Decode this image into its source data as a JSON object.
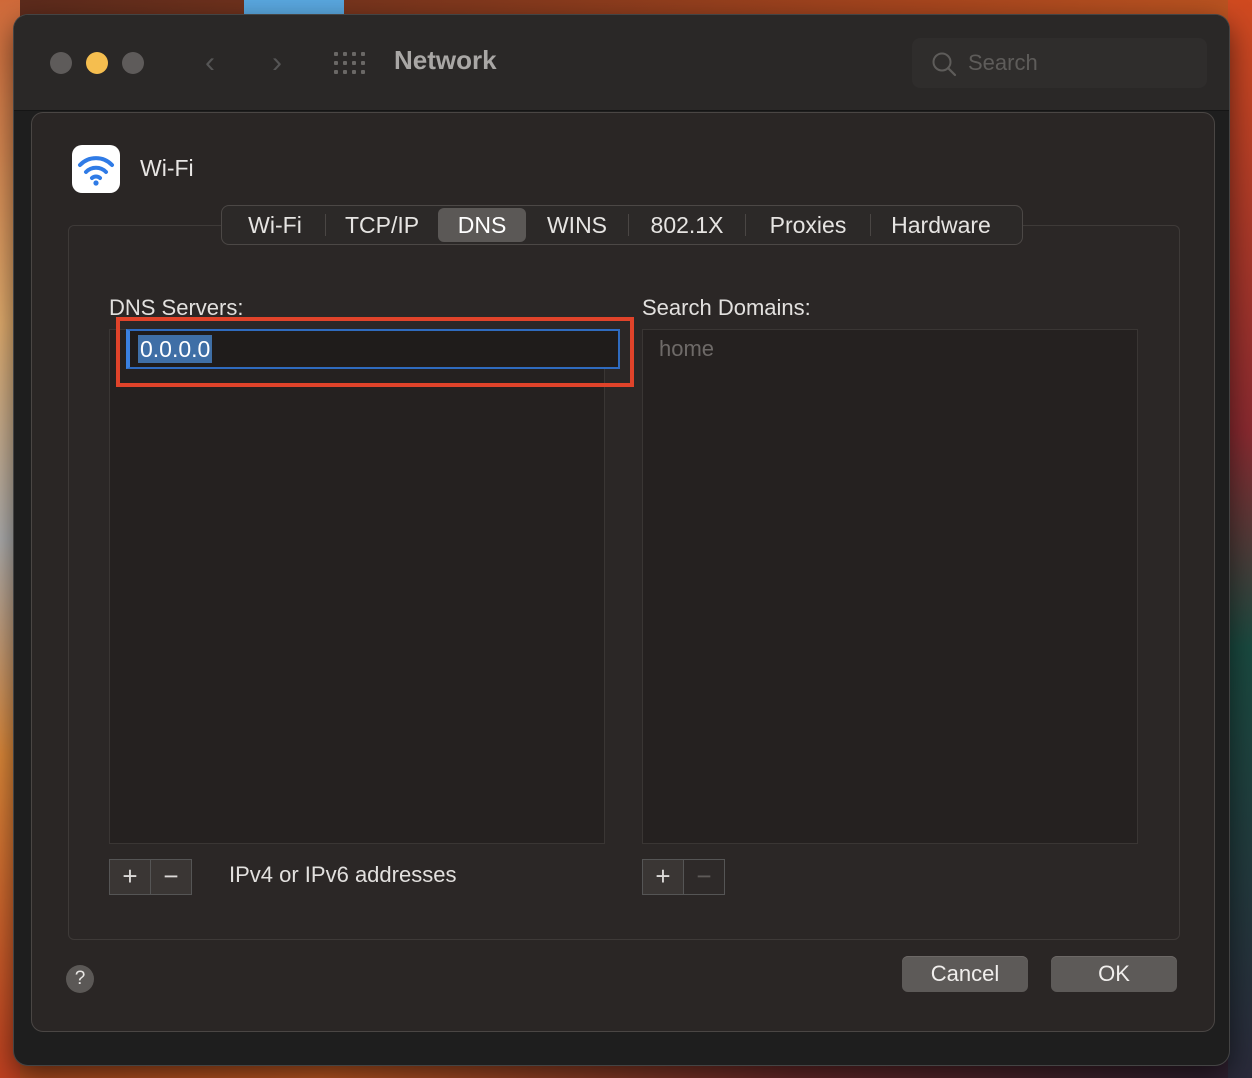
{
  "window": {
    "title": "Network"
  },
  "toolbar": {
    "search_placeholder": "Search"
  },
  "sheet": {
    "service_name": "Wi-Fi",
    "tabs": [
      {
        "label": "Wi-Fi"
      },
      {
        "label": "TCP/IP"
      },
      {
        "label": "DNS",
        "selected": true
      },
      {
        "label": "WINS"
      },
      {
        "label": "802.1X"
      },
      {
        "label": "Proxies"
      },
      {
        "label": "Hardware"
      }
    ],
    "dns": {
      "label": "DNS Servers:",
      "servers": [
        "0.0.0.0"
      ],
      "add": "+",
      "remove": "−",
      "hint": "IPv4 or IPv6 addresses"
    },
    "domains": {
      "label": "Search Domains:",
      "items": [
        "home"
      ],
      "add": "+",
      "remove": "−"
    },
    "help": "?",
    "cancel": "Cancel",
    "ok": "OK"
  },
  "colors": {
    "highlight": "#e0432a",
    "accent": "#3a80e0",
    "minimize": "#f5be4f"
  }
}
